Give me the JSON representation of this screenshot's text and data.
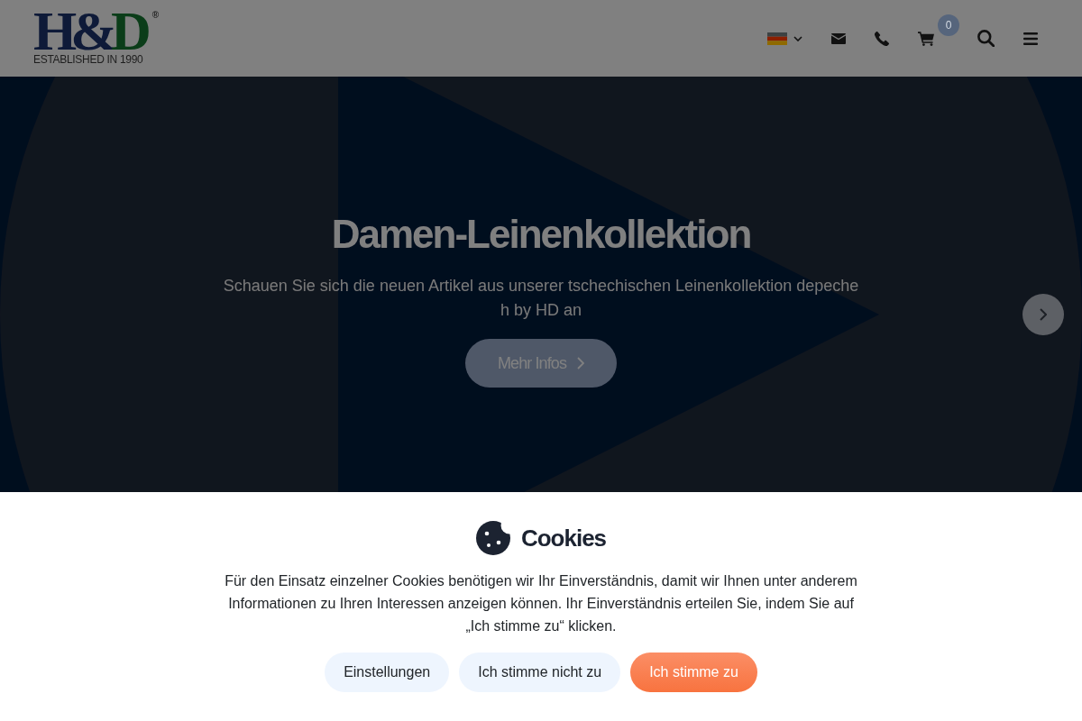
{
  "header": {
    "logo": {
      "mark_letters": [
        "H",
        "&",
        "D"
      ],
      "registered": "®",
      "tagline": "ESTABLISHED IN 1990"
    },
    "cart_count": "0"
  },
  "hero": {
    "title": "Damen-Leinenkollektion",
    "subtitle": "Schauen Sie sich die neuen Artikel aus unserer tschechischen Leinenkollektion depeche h by HD an",
    "button": "Mehr Infos"
  },
  "cookie_banner": {
    "modal": true,
    "title": "Cookies",
    "text": "Für den Einsatz einzelner Cookies benötigen wir Ihr Einverständnis, damit wir Ihnen unter anderem Informationen zu Ihren Interessen anzeigen können. Ihr Einverständnis erteilen Sie, indem Sie auf „Ich stimme zu“ klicken.",
    "buttons": [
      {
        "label": "Einstellungen",
        "kind": "secondary"
      },
      {
        "label": "Ich stimme nicht zu",
        "kind": "secondary"
      },
      {
        "label": "Ich stimme zu",
        "kind": "primary"
      }
    ]
  }
}
